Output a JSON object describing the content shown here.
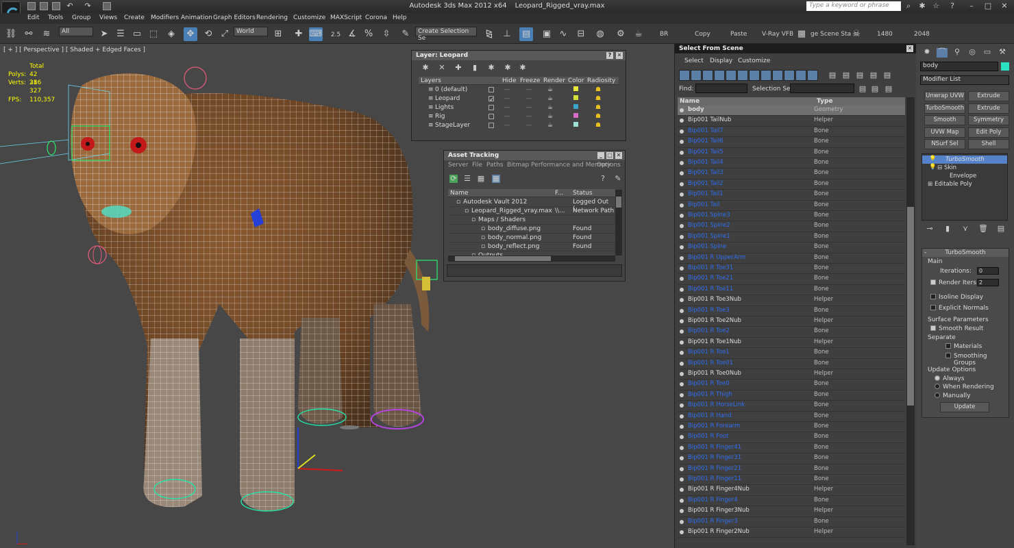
{
  "app": {
    "title_app": "Autodesk 3ds Max  2012 x64",
    "title_file": "Leopard_Rigged_vray.max",
    "search_placeholder": "Type a keyword or phrase"
  },
  "menu": [
    "Edit",
    "Tools",
    "Group",
    "Views",
    "Create",
    "Modifiers",
    "Animation",
    "Graph Editors",
    "Rendering",
    "Customize",
    "MAXScript",
    "Corona",
    "Help"
  ],
  "toolbar": {
    "filter": "All",
    "coord": "World",
    "snap_2_5": "2.5",
    "selection_set": "Create Selection Se",
    "labels": [
      "BR",
      "Copy",
      "Paste",
      "V-Ray VFB",
      "ge Scene Sta",
      "1480",
      "2048"
    ]
  },
  "viewport": {
    "label": "[ + ] [ Perspective ] [ Shaded + Edged Faces ]",
    "stats_total": "Total",
    "polys_label": "Polys:",
    "polys_value": "42 386",
    "verts_label": "Verts:",
    "verts_value": "21 327",
    "fps_label": "FPS:",
    "fps_value": "110,357"
  },
  "layer_panel": {
    "title": "Layer: Leopard",
    "headers": [
      "Layers",
      "Hide",
      "Freeze",
      "Render",
      "Color",
      "Radiosity"
    ],
    "rows": [
      {
        "name": "0 (default)",
        "color": "#e5e53a"
      },
      {
        "name": "Leopard",
        "color": "#d6e03a"
      },
      {
        "name": "Lights",
        "color": "#3aa7c8"
      },
      {
        "name": "Rig",
        "color": "#d66ec8"
      },
      {
        "name": "StageLayer",
        "color": "#9ee0d6"
      }
    ]
  },
  "asset_panel": {
    "title": "Asset Tracking",
    "menu": [
      "Server",
      "File",
      "Paths",
      "Bitmap Performance and Memory",
      "Options"
    ],
    "headers": [
      "Name",
      "F...",
      "Status"
    ],
    "rows": [
      {
        "name": "Autodesk Vault 2012",
        "f": "",
        "status": "Logged Out (..."
      },
      {
        "name": "Leopard_Rigged_vray.max",
        "f": "\\\\...",
        "status": "Network Path"
      },
      {
        "name": "Maps / Shaders",
        "f": "",
        "status": ""
      },
      {
        "name": "body_diffuse.png",
        "f": "",
        "status": "Found"
      },
      {
        "name": "body_normal.png",
        "f": "",
        "status": "Found"
      },
      {
        "name": "body_reflect.png",
        "f": "",
        "status": "Found"
      },
      {
        "name": "Outputs",
        "f": "",
        "status": ""
      }
    ]
  },
  "select_scene": {
    "title": "Select From Scene",
    "menu": [
      "Select",
      "Display",
      "Customize"
    ],
    "find_label": "Find:",
    "selset_label": "Selection Set:",
    "col_name": "Name",
    "col_type": "Type",
    "rows": [
      {
        "n": "body",
        "t": "Geometry",
        "k": "geo"
      },
      {
        "n": "Bip001 TailNub",
        "t": "Helper",
        "k": "helper"
      },
      {
        "n": "Bip001 Tail7",
        "t": "Bone",
        "k": "bone"
      },
      {
        "n": "Bip001 Tail6",
        "t": "Bone",
        "k": "bone"
      },
      {
        "n": "Bip001 Tail5",
        "t": "Bone",
        "k": "bone"
      },
      {
        "n": "Bip001 Tail4",
        "t": "Bone",
        "k": "bone"
      },
      {
        "n": "Bip001 Tail3",
        "t": "Bone",
        "k": "bone"
      },
      {
        "n": "Bip001 Tail2",
        "t": "Bone",
        "k": "bone"
      },
      {
        "n": "Bip001 Tail1",
        "t": "Bone",
        "k": "bone"
      },
      {
        "n": "Bip001 Tail",
        "t": "Bone",
        "k": "bone"
      },
      {
        "n": "Bip001 Spine3",
        "t": "Bone",
        "k": "bone"
      },
      {
        "n": "Bip001 Spine2",
        "t": "Bone",
        "k": "bone"
      },
      {
        "n": "Bip001 Spine1",
        "t": "Bone",
        "k": "bone"
      },
      {
        "n": "Bip001 Spine",
        "t": "Bone",
        "k": "bone"
      },
      {
        "n": "Bip001 R UpperArm",
        "t": "Bone",
        "k": "bone"
      },
      {
        "n": "Bip001 R Toe31",
        "t": "Bone",
        "k": "bone"
      },
      {
        "n": "Bip001 R Toe21",
        "t": "Bone",
        "k": "bone"
      },
      {
        "n": "Bip001 R Toe11",
        "t": "Bone",
        "k": "bone"
      },
      {
        "n": "Bip001 R Toe3Nub",
        "t": "Helper",
        "k": "helper"
      },
      {
        "n": "Bip001 R Toe3",
        "t": "Bone",
        "k": "bone"
      },
      {
        "n": "Bip001 R Toe2Nub",
        "t": "Helper",
        "k": "helper"
      },
      {
        "n": "Bip001 R Toe2",
        "t": "Bone",
        "k": "bone"
      },
      {
        "n": "Bip001 R Toe1Nub",
        "t": "Helper",
        "k": "helper"
      },
      {
        "n": "Bip001 R Toe1",
        "t": "Bone",
        "k": "bone"
      },
      {
        "n": "Bip001 R Toe01",
        "t": "Bone",
        "k": "bone"
      },
      {
        "n": "Bip001 R Toe0Nub",
        "t": "Helper",
        "k": "helper"
      },
      {
        "n": "Bip001 R Toe0",
        "t": "Bone",
        "k": "bone"
      },
      {
        "n": "Bip001 R Thigh",
        "t": "Bone",
        "k": "bone"
      },
      {
        "n": "Bip001 R HorseLink",
        "t": "Bone",
        "k": "bone"
      },
      {
        "n": "Bip001 R Hand",
        "t": "Bone",
        "k": "bone"
      },
      {
        "n": "Bip001 R Forearm",
        "t": "Bone",
        "k": "bone"
      },
      {
        "n": "Bip001 R Foot",
        "t": "Bone",
        "k": "bone"
      },
      {
        "n": "Bip001 R Finger41",
        "t": "Bone",
        "k": "bone"
      },
      {
        "n": "Bip001 R Finger31",
        "t": "Bone",
        "k": "bone"
      },
      {
        "n": "Bip001 R Finger21",
        "t": "Bone",
        "k": "bone"
      },
      {
        "n": "Bip001 R Finger11",
        "t": "Bone",
        "k": "bone"
      },
      {
        "n": "Bip001 R Finger4Nub",
        "t": "Helper",
        "k": "helper"
      },
      {
        "n": "Bip001 R Finger4",
        "t": "Bone",
        "k": "bone"
      },
      {
        "n": "Bip001 R Finger3Nub",
        "t": "Helper",
        "k": "helper"
      },
      {
        "n": "Bip001 R Finger3",
        "t": "Bone",
        "k": "bone"
      },
      {
        "n": "Bip001 R Finger2Nub",
        "t": "Helper",
        "k": "helper"
      }
    ]
  },
  "command_panel": {
    "object_name": "body",
    "modifier_list": "Modifier List",
    "buttons": [
      "Unwrap UVW",
      "Extrude",
      "TurboSmooth",
      "Extrude",
      "Smooth",
      "Symmetry",
      "UVW Map",
      "Edit Poly",
      "NSurf Sel",
      "Shell"
    ],
    "stack": [
      "TurboSmooth",
      "Skin",
      "Envelope",
      "Editable Poly"
    ],
    "rollout_title": "TurboSmooth",
    "main": "Main",
    "iterations_label": "Iterations:",
    "iterations_value": "0",
    "render_iters_label": "Render Iters:",
    "render_iters_value": "2",
    "isoline": "Isoline Display",
    "explicit": "Explicit Normals",
    "surface": "Surface Parameters",
    "smooth_result": "Smooth Result",
    "separate": "Separate",
    "materials": "Materials",
    "smoothing_groups": "Smoothing Groups",
    "update_options": "Update Options",
    "always": "Always",
    "when_rendering": "When Rendering",
    "manually": "Manually",
    "update_btn": "Update"
  }
}
